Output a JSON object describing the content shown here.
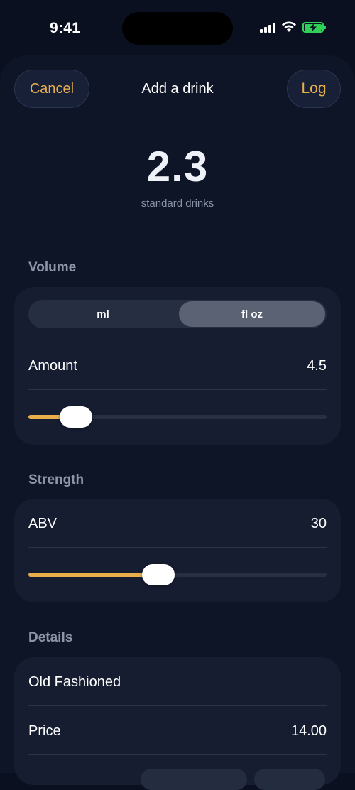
{
  "status": {
    "time": "9:41"
  },
  "sheet": {
    "cancel_label": "Cancel",
    "title": "Add a drink",
    "log_label": "Log"
  },
  "summary": {
    "value": "2.3",
    "caption": "standard drinks"
  },
  "volume": {
    "section_label": "Volume",
    "units": [
      "ml",
      "fl oz"
    ],
    "selected_unit": "fl oz",
    "amount_label": "Amount",
    "amount_value": "4.5",
    "slider_fraction": 0.16
  },
  "strength": {
    "section_label": "Strength",
    "abv_label": "ABV",
    "abv_value": "30",
    "slider_fraction": 0.435
  },
  "details": {
    "section_label": "Details",
    "name": "Old Fashioned",
    "price_label": "Price",
    "price_value": "14.00"
  },
  "colors": {
    "accent": "#e8ae4a",
    "background": "#0b1020",
    "card": "#161d31",
    "battery": "#30d158"
  }
}
